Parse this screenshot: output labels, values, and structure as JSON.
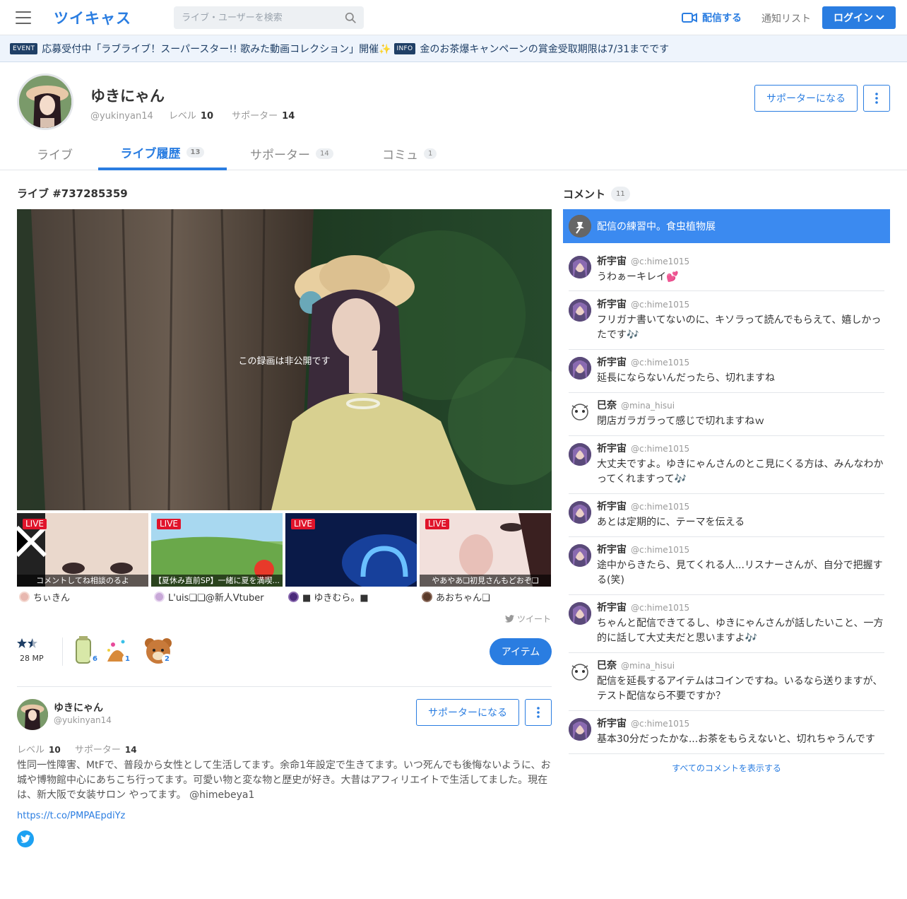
{
  "header": {
    "logo": "ツイキャス",
    "search_placeholder": "ライブ・ユーザーを検索",
    "broadcast_label": "配信する",
    "notify_label": "通知リスト",
    "login_label": "ログイン"
  },
  "banner": [
    {
      "tag": "EVENT",
      "text": "応募受付中「ラブライブ！スーパースター!! 歌みた動画コレクション」開催✨"
    },
    {
      "tag": "INFO",
      "text": "金のお茶爆キャンペーンの賞金受取期限は7/31までです"
    }
  ],
  "profile": {
    "name": "ゆきにゃん",
    "handle": "@yukinyan14",
    "level_label": "レベル",
    "level": "10",
    "supporter_label": "サポーター",
    "supporters": "14",
    "supporter_button": "サポーターになる"
  },
  "tabs": [
    {
      "label": "ライブ",
      "count": ""
    },
    {
      "label": "ライブ履歴",
      "count": "13"
    },
    {
      "label": "サポーター",
      "count": "14"
    },
    {
      "label": "コミュ",
      "count": "1"
    }
  ],
  "live": {
    "title": "ライブ #737285359",
    "private_message": "この録画は非公開です",
    "live_badge": "LIVE"
  },
  "thumbs": [
    {
      "caption": "コメントしてね相談のるよ",
      "user": "ちぃきん"
    },
    {
      "caption": "【夏休み直前SP】一緒に夏を満喫...",
      "user": "L'uis❏❏@新人Vtuber"
    },
    {
      "caption": "",
      "user": "■ ゆきむら。■"
    },
    {
      "caption": "やあやあ❏初見さんもどおぞ❏",
      "user": "あおちゃん❏"
    }
  ],
  "tweet_label": "ツイート",
  "mp": {
    "value": "28 MP"
  },
  "items": [
    {
      "icon": "tea-bottle-icon",
      "count": "6"
    },
    {
      "icon": "sparkle-hat-icon",
      "count": "1"
    },
    {
      "icon": "bear-icon",
      "count": "2"
    }
  ],
  "item_button": "アイテム",
  "user_card": {
    "name": "ゆきにゃん",
    "handle": "@yukinyan14",
    "level_label": "レベル",
    "level": "10",
    "supporter_label": "サポーター",
    "supporters": "14",
    "supporter_button": "サポーターになる",
    "bio": "性同一性障害、MtFで、普段から女性として生活してます。余命1年設定で生きてます。いつ死んでも後悔ないように、お城や博物館中心にあちこち行ってます。可愛い物と変な物と歴史が好き。大昔はアフィリエイトで生活してました。現在は、新大阪で女装サロン やってます。 @himebeya1",
    "link": "https://t.co/PMPAEpdiYz"
  },
  "comments": {
    "title": "コメント",
    "count": "11",
    "pinned": "配信の練習中。食虫植物展",
    "items": [
      {
        "name": "祈宇宙",
        "handle": "@c:hime1015",
        "text": "うわぁーキレイ💕"
      },
      {
        "name": "祈宇宙",
        "handle": "@c:hime1015",
        "text": "フリガナ書いてないのに、キソラって読んでもらえて、嬉しかったです🎶"
      },
      {
        "name": "祈宇宙",
        "handle": "@c:hime1015",
        "text": "延長にならないんだったら、切れますね"
      },
      {
        "name": "巳奈",
        "handle": "@mina_hisui",
        "text": "閉店ガラガラって感じで切れますねｗ"
      },
      {
        "name": "祈宇宙",
        "handle": "@c:hime1015",
        "text": "大丈夫ですよ。ゆきにゃんさんのとこ見にくる方は、みんなわかってくれますって🎶"
      },
      {
        "name": "祈宇宙",
        "handle": "@c:hime1015",
        "text": "あとは定期的に、テーマを伝える"
      },
      {
        "name": "祈宇宙",
        "handle": "@c:hime1015",
        "text": "途中からきたら、見てくれる人...リスナーさんが、自分で把握する(笑)"
      },
      {
        "name": "祈宇宙",
        "handle": "@c:hime1015",
        "text": "ちゃんと配信できてるし、ゆきにゃんさんが話したいこと、一方的に話して大丈夫だと思いますよ🎶"
      },
      {
        "name": "巳奈",
        "handle": "@mina_hisui",
        "text": "配信を延長するアイテムはコインですね。いるなら送りますが、テスト配信なら不要ですか？"
      },
      {
        "name": "祈宇宙",
        "handle": "@c:hime1015",
        "text": "基本30分だったかな...お茶をもらえないと、切れちゃうんです"
      }
    ],
    "show_all": "すべてのコメントを表示する"
  },
  "colors": {
    "accent": "#2a7de1",
    "live_red": "#e0142b",
    "twitter": "#1da1f2"
  }
}
